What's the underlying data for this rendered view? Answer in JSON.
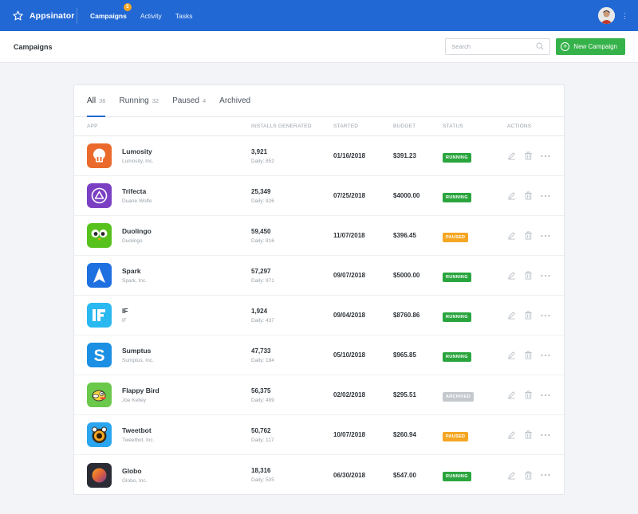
{
  "nav": {
    "brand": "Appsinator",
    "items": [
      {
        "label": "Campaigns",
        "active": true,
        "badge": "5"
      },
      {
        "label": "Activity"
      },
      {
        "label": "Tasks"
      }
    ]
  },
  "page": {
    "title": "Campaigns"
  },
  "search": {
    "placeholder": "Search"
  },
  "new_button": {
    "label": "New Campaign"
  },
  "tabs": [
    {
      "label": "All",
      "count": "36",
      "active": true
    },
    {
      "label": "Running",
      "count": "32"
    },
    {
      "label": "Paused",
      "count": "4"
    },
    {
      "label": "Archived",
      "count": ""
    }
  ],
  "columns": [
    "APP",
    "INSTALLS GENERATED",
    "STARTED",
    "BUDGET",
    "STATUS",
    "ACTIONS"
  ],
  "rows": [
    {
      "name": "Lumosity",
      "publisher": "Lumosity, Inc.",
      "installs": "3,921",
      "daily": "Daily: 852",
      "started": "01/16/2018",
      "budget": "$391.23",
      "status": "RUNNING",
      "icon": "lumosity-icon",
      "color": "#ea6a2c"
    },
    {
      "name": "Trifecta",
      "publisher": "Duane Wolfe",
      "installs": "25,349",
      "daily": "Daily: 926",
      "started": "07/25/2018",
      "budget": "$4000.00",
      "status": "RUNNING",
      "icon": "trifecta-icon",
      "color": "#7b3fc4"
    },
    {
      "name": "Duolingo",
      "publisher": "Duolingo",
      "installs": "59,450",
      "daily": "Daily: 816",
      "started": "11/07/2018",
      "budget": "$396.45",
      "status": "PAUSED",
      "icon": "duolingo-icon",
      "color": "#58c21c"
    },
    {
      "name": "Spark",
      "publisher": "Spark, Inc.",
      "installs": "57,297",
      "daily": "Daily: 971",
      "started": "09/07/2018",
      "budget": "$5000.00",
      "status": "RUNNING",
      "icon": "spark-icon",
      "color": "#1e6fe0"
    },
    {
      "name": "IF",
      "publisher": "IF",
      "installs": "1,924",
      "daily": "Daily: 437",
      "started": "09/04/2018",
      "budget": "$8760.86",
      "status": "RUNNING",
      "icon": "if-icon",
      "color": "#29b8f0"
    },
    {
      "name": "Sumptus",
      "publisher": "Sumptus, Inc.",
      "installs": "47,733",
      "daily": "Daily: 184",
      "started": "05/10/2018",
      "budget": "$965.85",
      "status": "RUNNING",
      "icon": "sumptus-icon",
      "color": "#1a8fe3"
    },
    {
      "name": "Flappy Bird",
      "publisher": "Joe Kelley",
      "installs": "56,375",
      "daily": "Daily: 499",
      "started": "02/02/2018",
      "budget": "$295.51",
      "status": "ARCHIVED",
      "icon": "flappy-bird-icon",
      "color": "#6ac84a"
    },
    {
      "name": "Tweetbot",
      "publisher": "Tweetbot, Inc.",
      "installs": "50,762",
      "daily": "Daily: 117",
      "started": "10/07/2018",
      "budget": "$260.94",
      "status": "PAUSED",
      "icon": "tweetbot-icon",
      "color": "#2aa5f0"
    },
    {
      "name": "Globo",
      "publisher": "Globo, Inc.",
      "installs": "18,316",
      "daily": "Daily: 505",
      "started": "06/30/2018",
      "budget": "$547.00",
      "status": "RUNNING",
      "icon": "globo-icon",
      "color": "#2b2b35"
    }
  ]
}
